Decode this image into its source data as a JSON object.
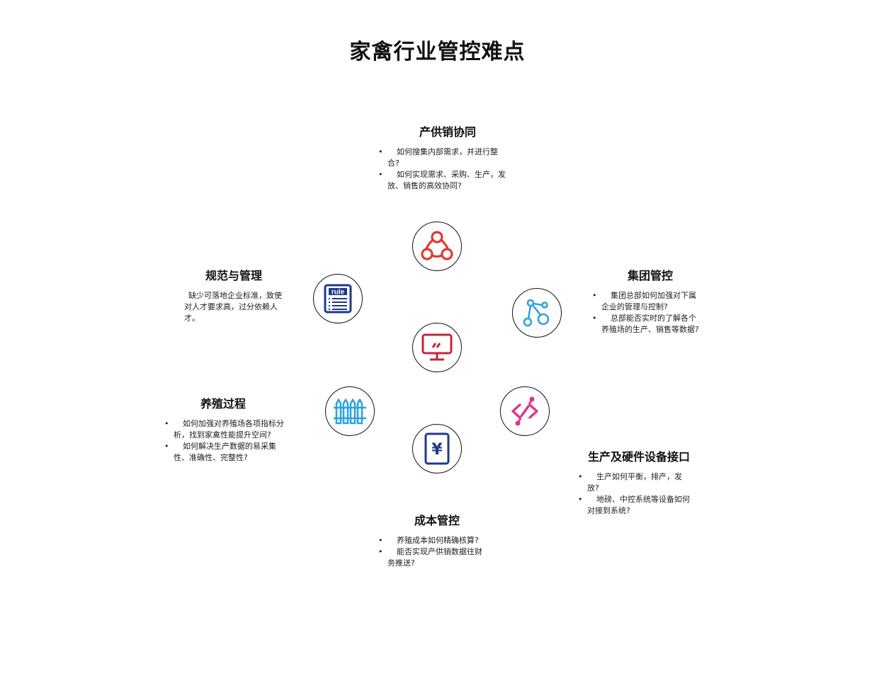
{
  "title": "家禽行业管控难点",
  "sections": [
    {
      "name": "产供销协同",
      "items": [
        "如何搜集内部需求，并进行整合?",
        "如何实现需求、采购、生产，发放、销售的高效协同?"
      ],
      "icon": "share-nodes-icon",
      "color": "#e03a2e"
    },
    {
      "name": "规范与管理",
      "desc": "缺少可落地企业标准，致使对人才要求高，过分依赖人才。",
      "icon": "rule-document-icon",
      "color": "#1f3a8a"
    },
    {
      "name": "集团管控",
      "items": [
        "集团总部如何加强对下属企业的管理与控制?",
        "总部能否实时的了解各个养殖场的生产、销售等数据?"
      ],
      "icon": "network-nodes-icon",
      "color": "#2ea3e0"
    },
    {
      "name": "养殖过程",
      "items": [
        "如何加强对养殖场各项指标分析，找到家禽性能提升空间?",
        "如何解决生产数据的易采集性、准确性、完整性?"
      ],
      "icon": "fence-icon",
      "color": "#2ea3e0"
    },
    {
      "name": "生产及硬件设备接口",
      "items": [
        "生产如何平衡，排产，发放?",
        "地磅、中控系统等设备如何对接到系统?"
      ],
      "icon": "interface-link-icon",
      "color": "#e0338f"
    },
    {
      "name": "成本管控",
      "items": [
        "养殖成本如何精确核算?",
        "能否实现产供销数据往财务推送?"
      ],
      "icon": "yuan-document-icon",
      "color": "#1f3a8a"
    }
  ],
  "center_icon": {
    "icon": "monitor-icon",
    "color": "#c0283c"
  },
  "rule_icon_text": "rule",
  "yuan_symbol": "¥"
}
